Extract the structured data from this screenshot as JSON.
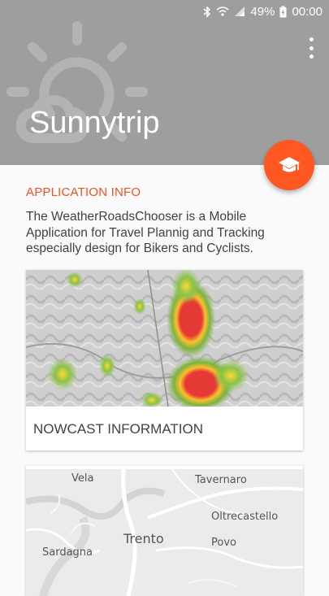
{
  "status_bar": {
    "battery": "49%",
    "time": "00:00",
    "icons": [
      "bluetooth-icon",
      "wifi-icon",
      "signal-icon",
      "battery-charging-icon"
    ]
  },
  "header": {
    "title": "Sunnytrip",
    "background_icon": "sun-cloud-icon",
    "menu_icon": "overflow-menu-icon",
    "background_color": "#9e9e9e"
  },
  "fab": {
    "icon": "school-icon",
    "color": "#ff5722"
  },
  "info": {
    "section_title": "APPLICATION INFO",
    "description": "The WeatherRoadsChooser is a Mobile Application for Travel Plannig and Tracking especially design for Bikers and Cyclists.",
    "accent_color": "#f4511e"
  },
  "cards": {
    "nowcast": {
      "label": "NOWCAST INFORMATION",
      "image": "radar-map-image"
    },
    "map": {
      "image": "road-map-image",
      "places": {
        "vela": "Vela",
        "tavernaro": "Tavernaro",
        "oltrecastello": "Oltrecastello",
        "trento": "Trento",
        "povo": "Povo",
        "sardagna": "Sardagna"
      }
    }
  }
}
